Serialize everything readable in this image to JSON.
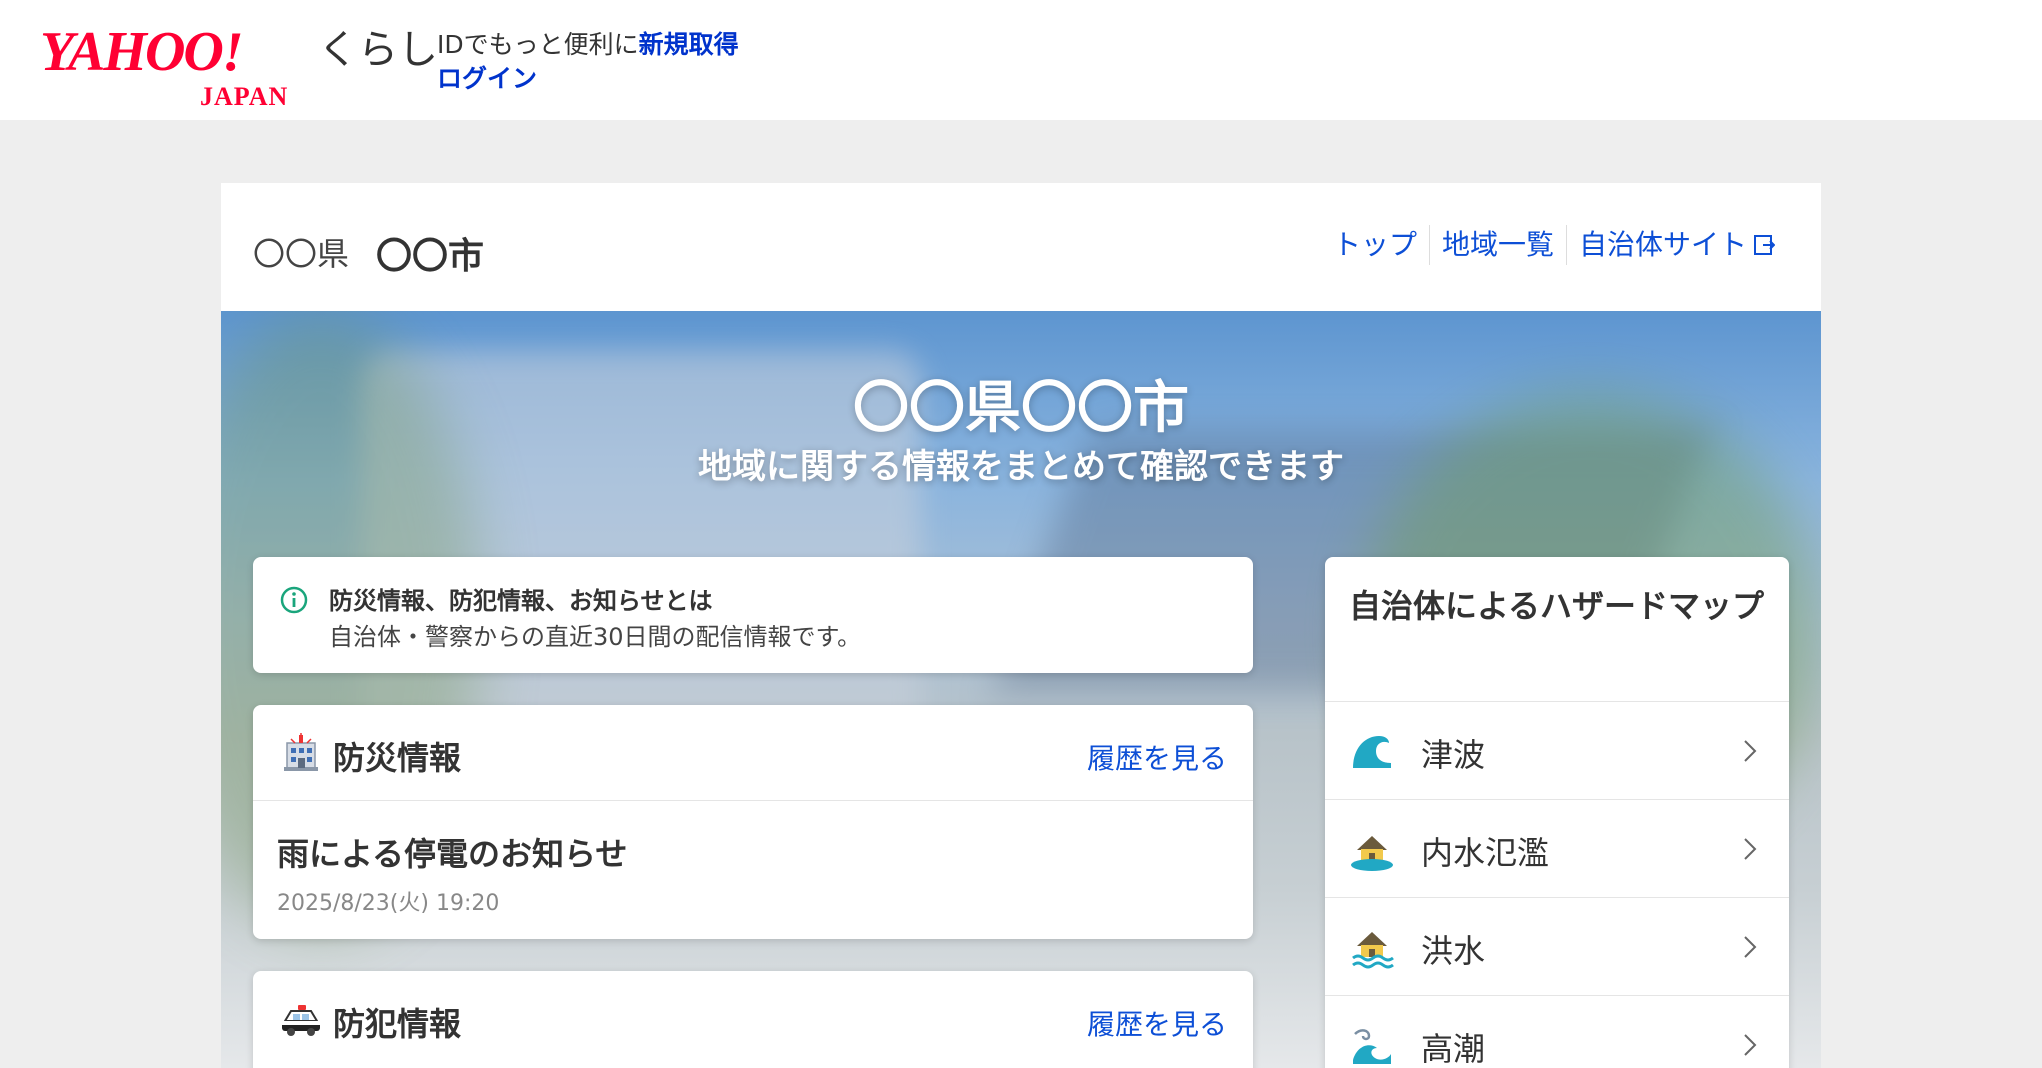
{
  "header": {
    "logo_main": "YAHOO!",
    "logo_sub": "JAPAN",
    "brand_sub": "くらし",
    "login_prompt": "IDでもっと便利に",
    "register_label": "新規取得",
    "login_label": "ログイン"
  },
  "region_bar": {
    "prefecture": "〇〇県",
    "city": "〇〇市",
    "nav": [
      {
        "label": "トップ"
      },
      {
        "label": "地域一覧"
      },
      {
        "label": "自治体サイト"
      }
    ]
  },
  "hero": {
    "title": "〇〇県〇〇市",
    "subtitle": "地域に関する情報をまとめて確認できます"
  },
  "info_box": {
    "title": "防災情報、防犯情報、お知らせとは",
    "description": "自治体・警察からの直近30日間の配信情報です。"
  },
  "sections": {
    "disaster": {
      "title": "防災情報",
      "history_label": "履歴を見る",
      "latest": {
        "title": "雨による停電のお知らせ",
        "date": "2025/8/23(火) 19:20"
      }
    },
    "crime": {
      "title": "防犯情報",
      "history_label": "履歴を見る"
    }
  },
  "hazard_map": {
    "title": "自治体によるハザードマップ",
    "items": [
      {
        "label": "津波",
        "icon": "tsunami-icon"
      },
      {
        "label": "内水氾濫",
        "icon": "inland-flood-icon"
      },
      {
        "label": "洪水",
        "icon": "flood-icon"
      },
      {
        "label": "高潮",
        "icon": "storm-surge-icon"
      }
    ]
  },
  "colors": {
    "brand_red": "#ff0033",
    "link_blue": "#0d4fd6",
    "header_link_blue": "#0033cc",
    "info_green": "#1aa57c",
    "hazard_teal": "#21a8c4"
  }
}
